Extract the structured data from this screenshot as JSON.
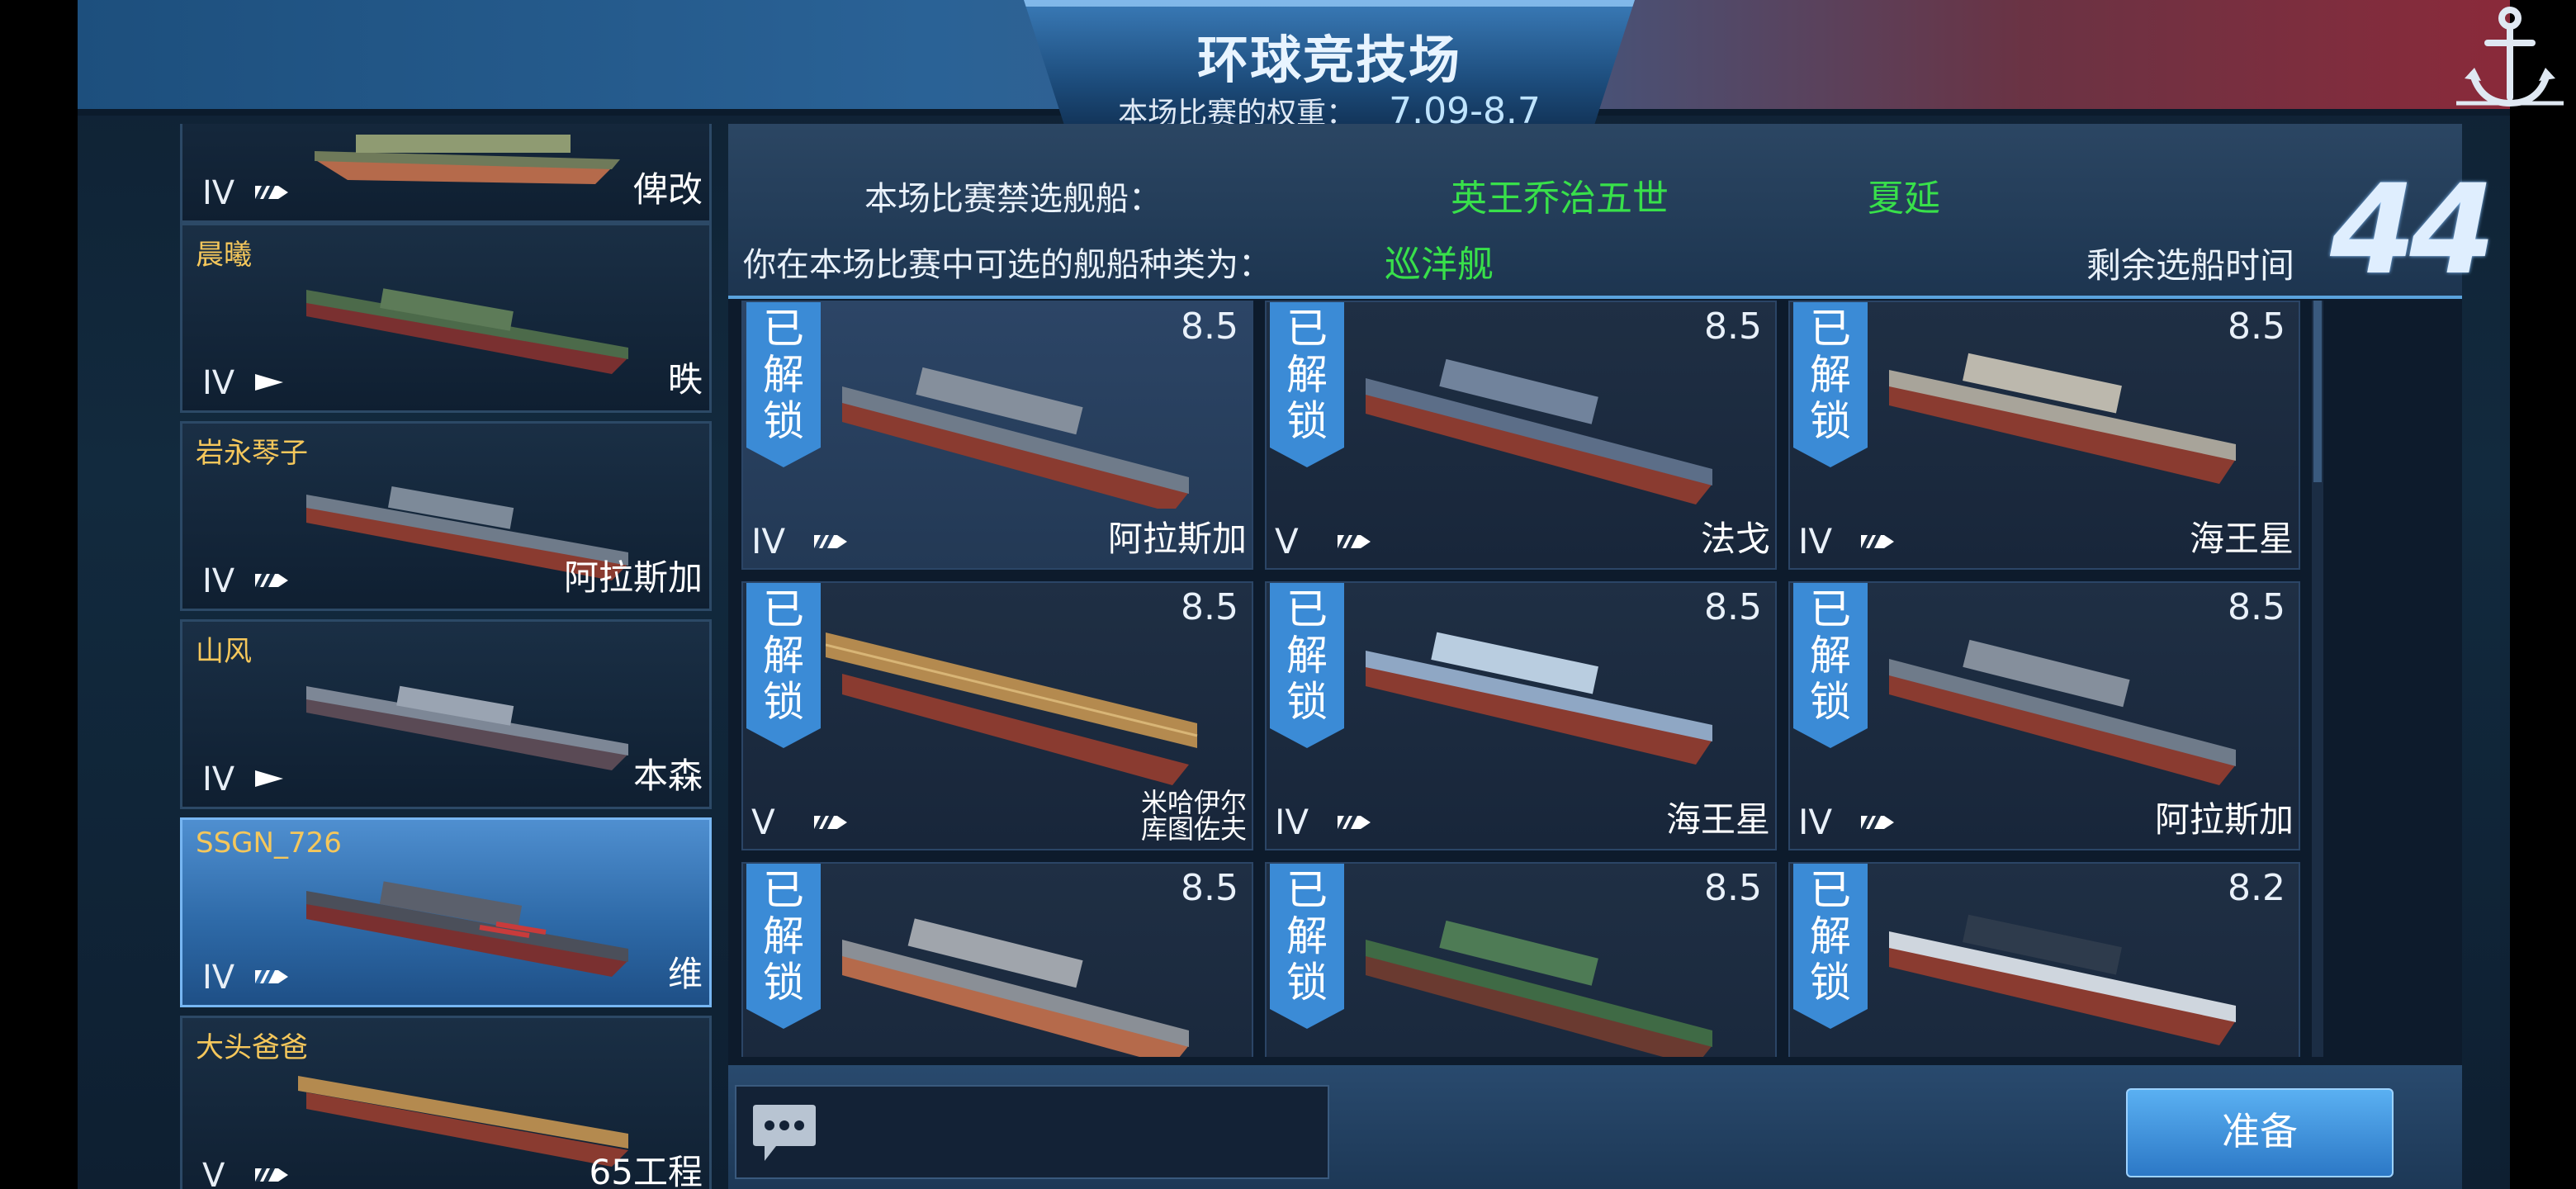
{
  "header": {
    "title": "环球竞技场",
    "weight_label": "本场比赛的权重：",
    "weight_value": "7.09-8.7"
  },
  "info": {
    "ban_label": "本场比赛禁选舰船：",
    "banned_ships": [
      "英王乔治五世",
      "夏延"
    ],
    "type_label": "你在本场比赛中可选的舰船种类为：",
    "ship_type": "巡洋舰",
    "timer_label": "剩余选船时间",
    "timer_value": "44"
  },
  "side_list": [
    {
      "owner": "",
      "tier": "IV",
      "name": "俾改",
      "icon": "cruiser-icon"
    },
    {
      "owner": "晨曦",
      "tier": "IV",
      "name": "昳",
      "icon": "destroyer-icon"
    },
    {
      "owner": "岩永琴子",
      "tier": "IV",
      "name": "阿拉斯加",
      "icon": "cruiser-icon"
    },
    {
      "owner": "山风",
      "tier": "IV",
      "name": "本森",
      "icon": "destroyer-icon"
    },
    {
      "owner": "SSGN_726",
      "tier": "IV",
      "name": "维",
      "icon": "cruiser-icon",
      "selected": true
    },
    {
      "owner": "大头爸爸",
      "tier": "V",
      "name": "65工程",
      "icon": "cruiser-icon"
    }
  ],
  "ships": [
    {
      "tag": "已解锁",
      "rating": "8.5",
      "tier": "IV",
      "name": "阿拉斯加"
    },
    {
      "tag": "已解锁",
      "rating": "8.5",
      "tier": "V",
      "name": "法戈"
    },
    {
      "tag": "已解锁",
      "rating": "8.5",
      "tier": "IV",
      "name": "海王星"
    },
    {
      "tag": "已解锁",
      "rating": "8.5",
      "tier": "V",
      "name": "米哈伊尔库图佐夫"
    },
    {
      "tag": "已解锁",
      "rating": "8.5",
      "tier": "IV",
      "name": "海王星"
    },
    {
      "tag": "已解锁",
      "rating": "8.5",
      "tier": "IV",
      "name": "阿拉斯加"
    },
    {
      "tag": "已解锁",
      "rating": "8.5",
      "tier": "",
      "name": ""
    },
    {
      "tag": "已解锁",
      "rating": "8.5",
      "tier": "",
      "name": ""
    },
    {
      "tag": "已解锁",
      "rating": "8.2",
      "tier": "",
      "name": ""
    }
  ],
  "ship_names_split": {
    "mikhail_line1": "米哈伊尔",
    "mikhail_line2": "库图佐夫"
  },
  "buttons": {
    "ready": "准备"
  },
  "icons": [
    "anchor-icon",
    "chat-icon",
    "cruiser-icon",
    "destroyer-icon"
  ],
  "colors": {
    "accent_blue": "#3b8bd6",
    "ban_green": "#38e04a",
    "owner_gold": "#f5c75b"
  }
}
